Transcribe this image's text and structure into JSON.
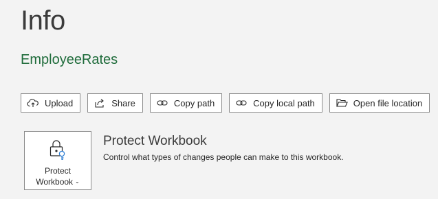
{
  "page": {
    "title": "Info",
    "document_name": "EmployeeRates"
  },
  "toolbar": {
    "buttons": [
      {
        "label": "Upload",
        "icon": "cloud-upload-icon"
      },
      {
        "label": "Share",
        "icon": "share-icon"
      },
      {
        "label": "Copy path",
        "icon": "link-icon"
      },
      {
        "label": "Copy local path",
        "icon": "link-icon"
      },
      {
        "label": "Open file location",
        "icon": "folder-open-icon"
      }
    ]
  },
  "protect": {
    "tile_line1": "Protect",
    "tile_line2": "Workbook",
    "title": "Protect Workbook",
    "description": "Control what types of changes people can make to this workbook.",
    "icon": "lock-key-icon"
  },
  "colors": {
    "background": "#f3f3f3",
    "document_name": "#1e6b3a",
    "button_border": "#8a8a8a"
  }
}
